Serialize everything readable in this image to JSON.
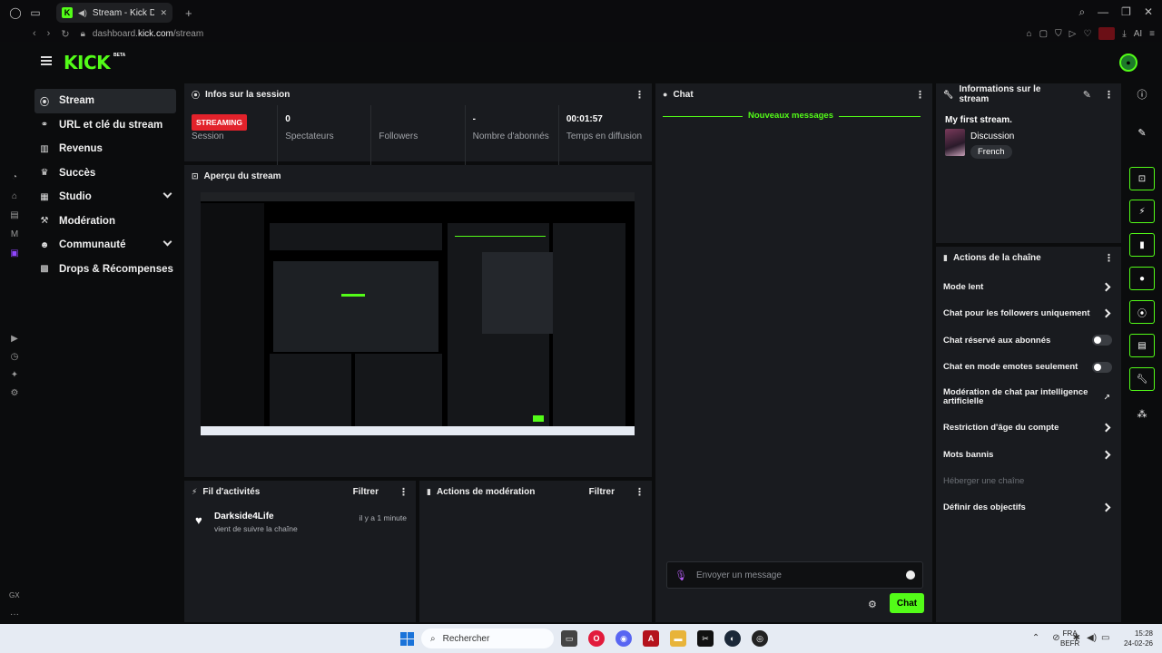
{
  "browser": {
    "tab_title": "Stream - Kick Dashboa",
    "url_host": "dashboard.",
    "url_domain": "kick.com",
    "url_path": "/stream",
    "ai_label": "AI"
  },
  "brand": {
    "logo": "KICK",
    "beta": "BETA",
    "accent": "#53fc18",
    "live_color": "#e2222b"
  },
  "sidebar": {
    "items": [
      {
        "label": "Stream",
        "icon": "broadcast-icon"
      },
      {
        "label": "URL et clé du stream",
        "icon": "link-icon"
      },
      {
        "label": "Revenus",
        "icon": "chart-icon"
      },
      {
        "label": "Succès",
        "icon": "trophy-icon"
      },
      {
        "label": "Studio",
        "icon": "studio-icon"
      },
      {
        "label": "Modération",
        "icon": "hammer-icon"
      },
      {
        "label": "Communauté",
        "icon": "community-icon"
      },
      {
        "label": "Drops & Récompenses",
        "icon": "gift-icon"
      }
    ]
  },
  "session": {
    "title": "Infos sur la session",
    "badge": "STREAMING",
    "session_label": "Session",
    "viewers_value": "0",
    "viewers_label": "Spectateurs",
    "followers_label": "Followers",
    "subs_value": "-",
    "subs_label": "Nombre d'abonnés",
    "time_value": "00:01:57",
    "time_label": "Temps en diffusion"
  },
  "preview": {
    "title": "Aperçu du stream"
  },
  "activity": {
    "title": "Fil d'activités",
    "filter": "Filtrer",
    "items": [
      {
        "name": "Darkside4Life",
        "text": "vient de suivre la chaîne",
        "time": "il y a 1 minute"
      }
    ]
  },
  "modactions": {
    "title": "Actions de modération",
    "filter": "Filtrer"
  },
  "chat": {
    "title": "Chat",
    "new_messages": "Nouveaux messages",
    "placeholder": "Envoyer un message",
    "send": "Chat"
  },
  "streaminfo": {
    "title": "Informations sur le stream",
    "stream_title": "My first stream.",
    "category": "Discussion",
    "language": "French"
  },
  "channel_actions": {
    "title": "Actions de la chaîne",
    "rows": [
      {
        "label": "Mode lent"
      },
      {
        "label": "Chat pour les followers uniquement"
      },
      {
        "label": "Chat réservé aux abonnés"
      },
      {
        "label": "Chat en mode emotes seulement"
      },
      {
        "label": "Modération de chat par intelligence artificielle"
      },
      {
        "label": "Restriction d'âge du compte"
      },
      {
        "label": "Mots bannis"
      },
      {
        "label": "Héberger une chaîne"
      },
      {
        "label": "Définir des objectifs"
      }
    ]
  },
  "taskbar": {
    "search_label": "Rechercher",
    "lang_line1": "FRA",
    "lang_line2": "BEFR",
    "time": "15:28",
    "date": "24-02-26"
  },
  "rail": {
    "gx_label": "GX"
  }
}
